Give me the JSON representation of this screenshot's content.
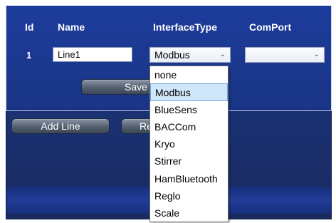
{
  "table": {
    "headers": {
      "id": "Id",
      "name": "Name",
      "interface": "InterfaceType",
      "comport": "ComPort"
    },
    "row": {
      "id": "1",
      "name_value": "Line1",
      "interface_value": "Modbus",
      "comport_value": ""
    }
  },
  "buttons": {
    "save": "Save",
    "add_line": "Add Line",
    "remove": "Re"
  },
  "dropdown": {
    "options": [
      "none",
      "Modbus",
      "BlueSens",
      "BACCom",
      "Kryo",
      "Stirrer",
      "HamBluetooth",
      "Reglo",
      "Scale"
    ],
    "selected": "Modbus"
  },
  "icons": {
    "chevron": "chevron-down-icon"
  },
  "colors": {
    "background": "#1b3478",
    "selected_option": "#cfe6f8"
  }
}
